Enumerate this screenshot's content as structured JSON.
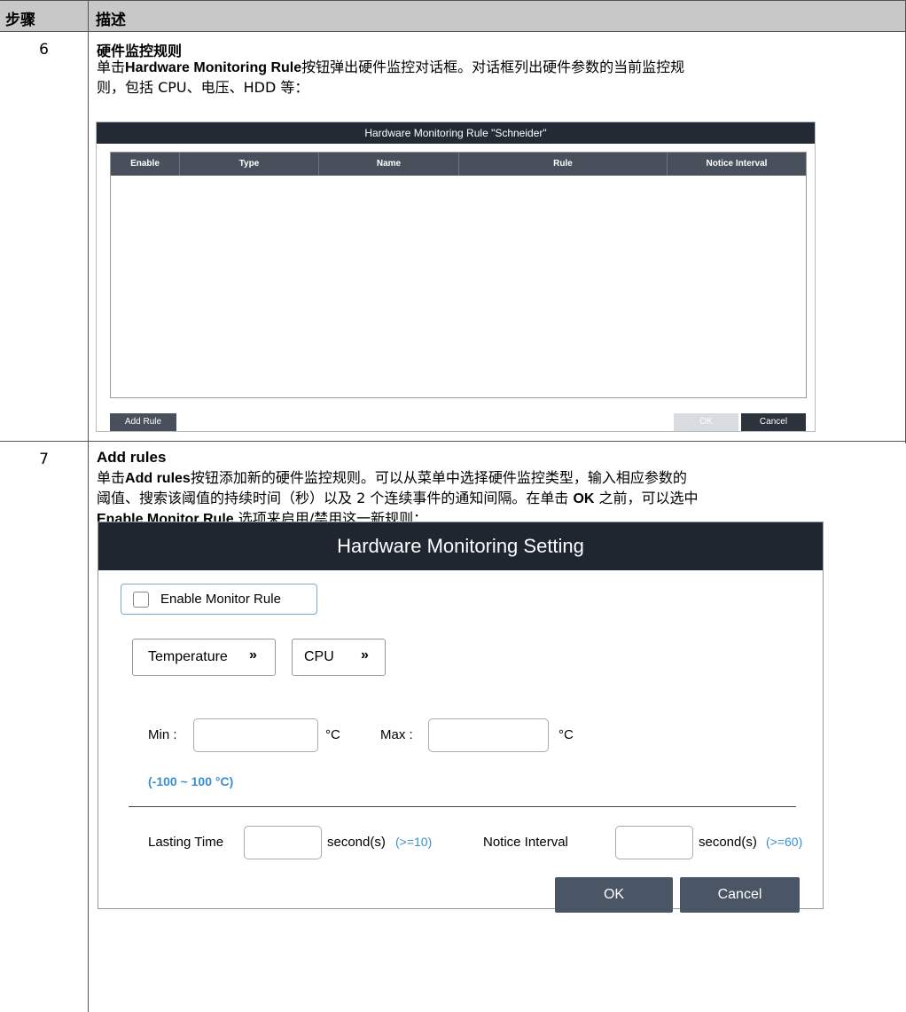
{
  "table": {
    "header_step": "步骤",
    "header_desc": "描述"
  },
  "step6": {
    "number": "6",
    "title": "硬件监控规则",
    "line1_pre": "单击",
    "line1_bold": "Hardware Monitoring Rule",
    "line1_post": "按钮弹出硬件监控对话框。对话框列出硬件参数的当前监控规",
    "line2": "则，包括 CPU、电压、HDD 等："
  },
  "dialog1": {
    "title": "Hardware Monitoring Rule \"Schneider\"",
    "columns": [
      "Enable",
      "Type",
      "Name",
      "Rule",
      "Notice Interval"
    ],
    "add_rule": "Add Rule",
    "ok": "OK",
    "cancel": "Cancel"
  },
  "step7": {
    "number": "7",
    "title": "Add rules",
    "line1_pre": "单击",
    "line1_bold": "Add rules",
    "line1_post": "按钮添加新的硬件监控规则。可以从菜单中选择硬件监控类型，输入相应参数的",
    "line2": "阈值、搜索该阈值的持续时间（秒）以及 2 个连续事件的通知间隔。在单击 ",
    "line2_bold": "OK",
    "line2_post": " 之前，可以选中",
    "line3_bold": "Enable Monitor Rule",
    "line3_post": " 选项来启用/禁用这一新规则："
  },
  "dialog2": {
    "title": "Hardware Monitoring Setting",
    "enable_label": "Enable Monitor Rule",
    "type_select": "Temperature",
    "target_select": "CPU",
    "min_label": "Min :",
    "max_label": "Max :",
    "unit": "°C",
    "range_hint": "(-100 ~ 100 °C)",
    "lasting_label": "Lasting Time",
    "seconds_label": "second(s)",
    "lasting_hint": "(>=10)",
    "notice_label": "Notice Interval",
    "notice_hint": "(>=60)",
    "ok": "OK",
    "cancel": "Cancel"
  },
  "colors": {
    "header_bg": "#c8c8c8",
    "dialog_title_bg": "#1f2630",
    "grid_header_bg": "#48505c",
    "hint_blue": "#3a8fd0",
    "button_bg": "#4a5565"
  }
}
